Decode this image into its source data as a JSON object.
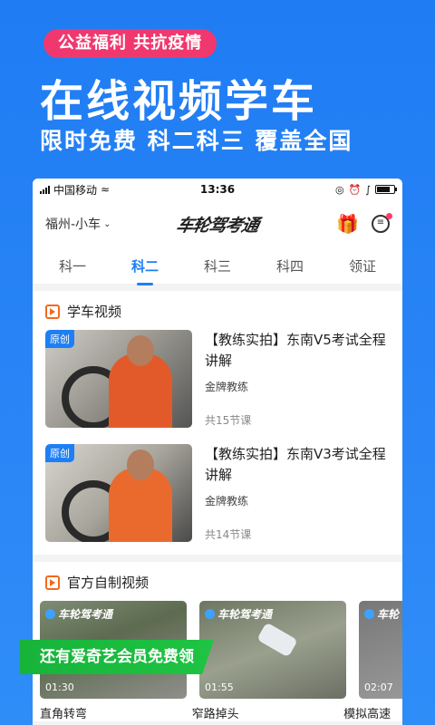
{
  "promo": {
    "tag": "公益福利  共抗疫情",
    "title": "在线视频学车",
    "subtitle": "限时免费  科二科三  覆盖全国"
  },
  "statusbar": {
    "carrier": "中国移动",
    "time": "13:36"
  },
  "appbar": {
    "city": "福州-小车",
    "logo": "车轮驾考通"
  },
  "tabs": [
    {
      "label": "科一"
    },
    {
      "label": "科二"
    },
    {
      "label": "科三"
    },
    {
      "label": "科四"
    },
    {
      "label": "领证"
    }
  ],
  "section1": {
    "title": "学车视频",
    "courses": [
      {
        "badge": "原创",
        "title": "【教练实拍】东南V5考试全程讲解",
        "coach": "金牌教练",
        "lessons": "共15节课"
      },
      {
        "badge": "原创",
        "title": "【教练实拍】东南V3考试全程讲解",
        "coach": "金牌教练",
        "lessons": "共14节课"
      }
    ]
  },
  "section2": {
    "title": "官方自制视频",
    "videos": [
      {
        "logo": "车轮驾考通",
        "time": "01:30",
        "label": "直角转弯"
      },
      {
        "logo": "车轮驾考通",
        "time": "01:55",
        "label": "窄路掉头"
      },
      {
        "logo": "车轮",
        "time": "02:07",
        "label": "模拟高速"
      }
    ]
  },
  "banner": {
    "text": "还有爱奇艺会员免费领"
  },
  "colors": {
    "accent": "#1e7ff5",
    "tag": "#f0386f",
    "banner": "#1fc443"
  }
}
